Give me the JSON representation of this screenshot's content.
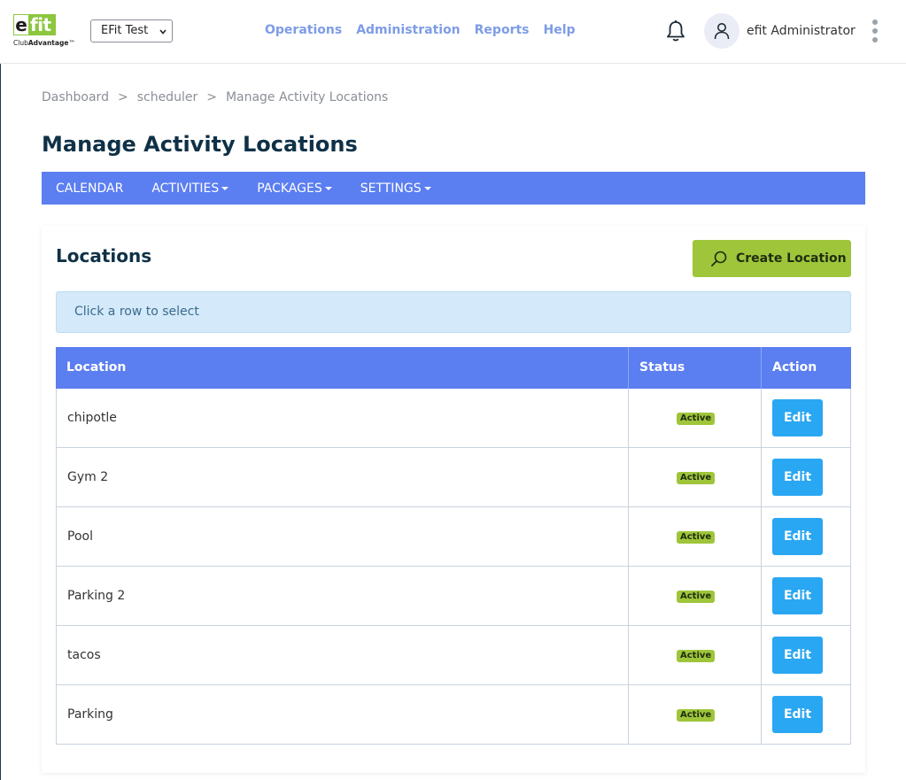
{
  "header": {
    "logo": {
      "mark": "efit",
      "mark_e": "e",
      "mark_fit": "fit",
      "tagline_club": "Club",
      "tagline_advantage": "Advantage",
      "tagline_tm": "™"
    },
    "club_select": {
      "value": "EFit Test",
      "icon": "chevron-down-icon"
    },
    "nav": [
      "Operations",
      "Administration",
      "Reports",
      "Help"
    ],
    "notification_icon": "bell-icon",
    "user_icon": "user-icon",
    "user_name": "efit Administrator",
    "menu_icon": "kebab-vertical-icon"
  },
  "breadcrumb": [
    "Dashboard",
    "scheduler",
    "Manage Activity Locations"
  ],
  "breadcrumb_separator": ">",
  "page_title": "Manage Activity Locations",
  "subnav": [
    {
      "label": "CALENDAR",
      "dropdown": false
    },
    {
      "label": "ACTIVITIES",
      "dropdown": true
    },
    {
      "label": "PACKAGES",
      "dropdown": true
    },
    {
      "label": "SETTINGS",
      "dropdown": true
    }
  ],
  "card": {
    "title": "Locations",
    "create_button": {
      "label": "Create Location",
      "icon": "search-icon"
    },
    "info_text": "Click a row to select"
  },
  "table": {
    "columns": [
      "Location",
      "Status",
      "Action"
    ],
    "rows": [
      {
        "location": "chipotle",
        "status": "Active",
        "action": "Edit"
      },
      {
        "location": "Gym 2",
        "status": "Active",
        "action": "Edit"
      },
      {
        "location": "Pool",
        "status": "Active",
        "action": "Edit"
      },
      {
        "location": "Parking 2",
        "status": "Active",
        "action": "Edit"
      },
      {
        "location": "tacos",
        "status": "Active",
        "action": "Edit"
      },
      {
        "location": "Parking",
        "status": "Active",
        "action": "Edit"
      }
    ]
  },
  "colors": {
    "accent_blue": "#5b7ef0",
    "nav_link": "#7e9ce6",
    "create_green": "#9fc53a",
    "edit_blue": "#2aa7f2",
    "title_navy": "#0f3147",
    "info_bg": "#d4e9f9"
  }
}
